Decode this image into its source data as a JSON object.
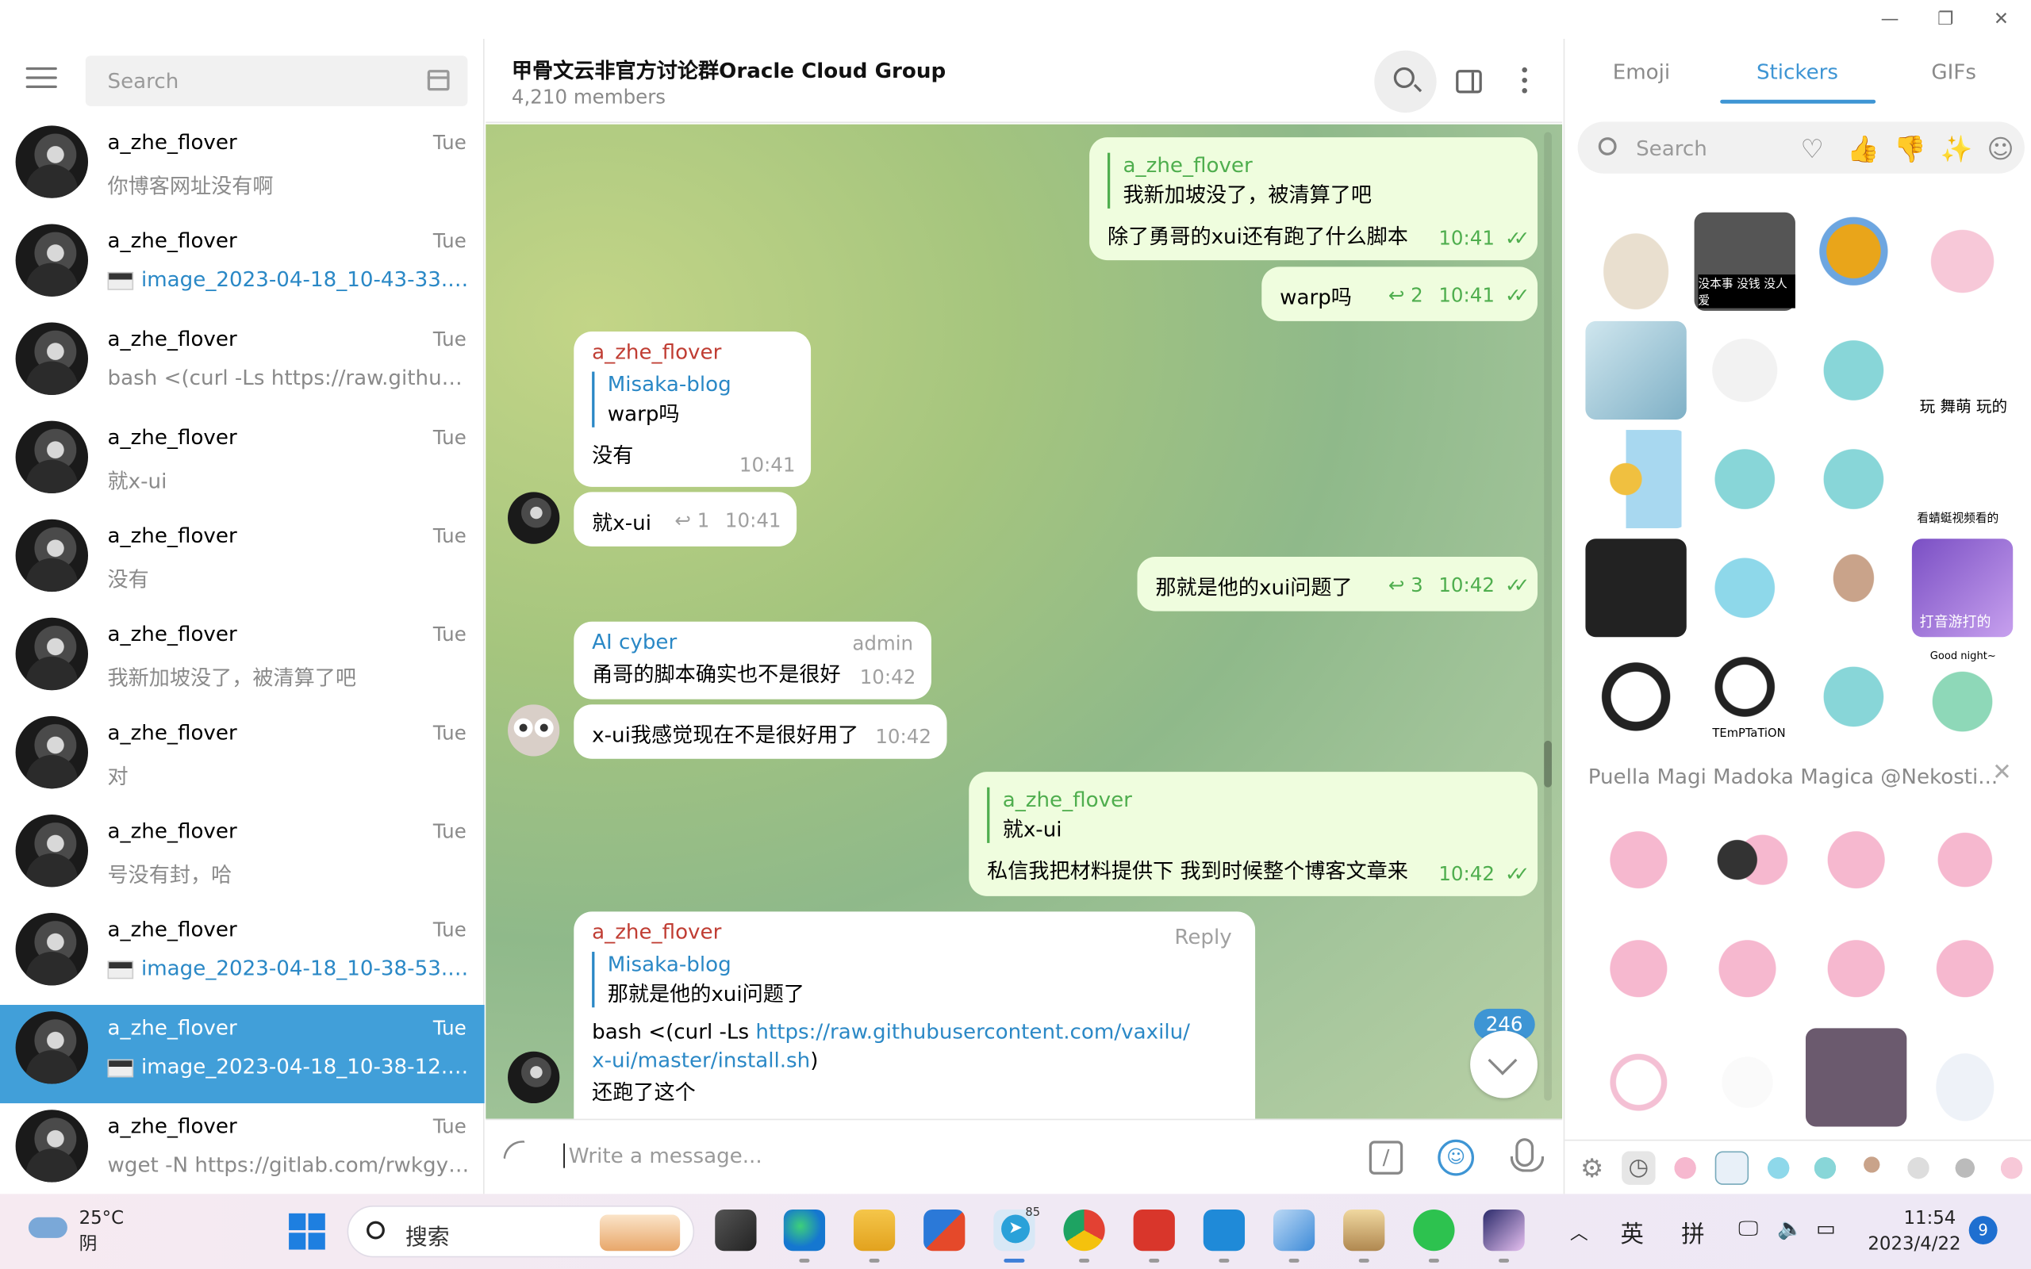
{
  "window": {
    "min": "—",
    "restore": "❐",
    "close": "✕"
  },
  "sidebar": {
    "search_placeholder": "Search",
    "chats": [
      {
        "name": "a_zhe_flover",
        "time": "Tue",
        "last": "你博客网址没有啊",
        "type": "text"
      },
      {
        "name": "a_zhe_flover",
        "time": "Tue",
        "last": "image_2023-04-18_10-43-33.png",
        "type": "file"
      },
      {
        "name": "a_zhe_flover",
        "time": "Tue",
        "last": "bash <(curl -Ls https://raw.githubus...",
        "type": "text"
      },
      {
        "name": "a_zhe_flover",
        "time": "Tue",
        "last": "就x-ui",
        "type": "text"
      },
      {
        "name": "a_zhe_flover",
        "time": "Tue",
        "last": "没有",
        "type": "text"
      },
      {
        "name": "a_zhe_flover",
        "time": "Tue",
        "last": "我新加坡没了，被清算了吧",
        "type": "text"
      },
      {
        "name": "a_zhe_flover",
        "time": "Tue",
        "last": "对",
        "type": "text"
      },
      {
        "name": "a_zhe_flover",
        "time": "Tue",
        "last": "号没有封，哈",
        "type": "text"
      },
      {
        "name": "a_zhe_flover",
        "time": "Tue",
        "last": "image_2023-04-18_10-38-53.png",
        "type": "file"
      },
      {
        "name": "a_zhe_flover",
        "time": "Tue",
        "last": "image_2023-04-18_10-38-12.png",
        "type": "file"
      },
      {
        "name": "a_zhe_flover",
        "time": "Tue",
        "last": "wget -N https://gitlab.com/rwkgyg/...",
        "type": "text"
      }
    ]
  },
  "header": {
    "title": "甲骨文云非官方讨论群Oracle Cloud Group",
    "members": "4,210 members"
  },
  "messages": {
    "m1": {
      "quote_name": "a_zhe_flover",
      "quote_text": "我新加坡没了，被清算了吧",
      "text": "除了勇哥的xui还有跑了什么脚本",
      "time": "10:41"
    },
    "m2": {
      "text": "warp吗",
      "replies": "2",
      "time": "10:41"
    },
    "m3": {
      "sender": "a_zhe_flover",
      "quote_name": "Misaka-blog",
      "quote_text": "warp吗",
      "text": "没有",
      "time": "10:41"
    },
    "m4": {
      "text": "就x-ui",
      "replies": "1",
      "time": "10:41"
    },
    "m5": {
      "text": "那就是他的xui问题了",
      "replies": "3",
      "time": "10:42"
    },
    "m6": {
      "sender": "AI cyber",
      "role": "admin",
      "text": "甬哥的脚本确实也不是很好",
      "time": "10:42"
    },
    "m7": {
      "text": "x-ui我感觉现在不是很好用了",
      "time": "10:42"
    },
    "m8": {
      "quote_name": "a_zhe_flover",
      "quote_text": "就x-ui",
      "text": "私信我把材料提供下 我到时候整个博客文章来",
      "time": "10:42"
    },
    "m9": {
      "sender": "a_zhe_flover",
      "reply_label": "Reply",
      "quote_name": "Misaka-blog",
      "quote_text": "那就是他的xui问题了",
      "text_prefix": "bash <(curl -Ls ",
      "link": "https://raw.githubusercontent.com/vaxilu/x-ui/master/install.sh",
      "text_suffix": ")",
      "text2": "还跑了这个"
    },
    "unread": "246"
  },
  "composer": {
    "placeholder": "Write a message..."
  },
  "stickers": {
    "tabs": [
      "Emoji",
      "Stickers",
      "GIFs"
    ],
    "search_placeholder": "Search",
    "set_title": "Puella Magi Madoka Magica @Nekosti...",
    "captions": [
      "没本事 没钱 没人爱",
      "玩 舞萌 玩的",
      "看蜻蜓视频看的",
      "打音游打的",
      "TEmPTaTiON",
      "Good night~"
    ]
  },
  "taskbar": {
    "weather_temp": "25°C",
    "weather_desc": "阴",
    "search_text": "搜索",
    "telegram_badge": "85",
    "ime_lang": "英",
    "ime_mode": "拼",
    "time": "11:54",
    "date": "2023/4/22",
    "notifications": "9"
  },
  "colors": {
    "accent": "#3e95d4",
    "out_bubble": "#effdde",
    "active_chat": "#419fd9",
    "green_name": "#4fae4e",
    "red_name": "#c03d33",
    "cyan_name": "#2a88c6"
  }
}
